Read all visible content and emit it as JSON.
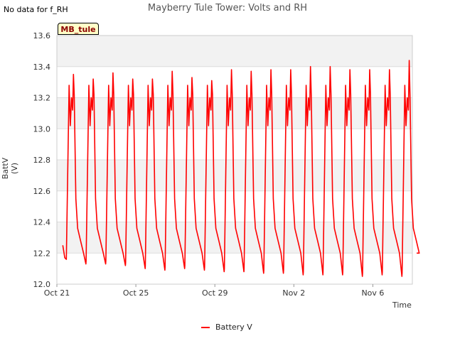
{
  "header": {
    "no_data_note": "No data for f_RH",
    "title": "Mayberry Tule Tower: Volts and RH",
    "site_tag": "MB_tule"
  },
  "chart_data": {
    "type": "line",
    "title": "Mayberry Tule Tower: Volts and RH",
    "xlabel": "Time",
    "ylabel": "BattV (V)",
    "ylim": [
      12.0,
      13.6
    ],
    "yticks": [
      "12.0",
      "12.2",
      "12.4",
      "12.6",
      "12.8",
      "13.0",
      "13.2",
      "13.4",
      "13.6"
    ],
    "xlim": [
      0,
      18
    ],
    "xticks": [
      {
        "label": "Oct 21",
        "day": 0
      },
      {
        "label": "Oct 25",
        "day": 4
      },
      {
        "label": "Oct 29",
        "day": 8
      },
      {
        "label": "Nov 2",
        "day": 12
      },
      {
        "label": "Nov 6",
        "day": 16
      }
    ],
    "grid": true,
    "legend_position": "bottom-center",
    "series": [
      {
        "name": "Battery V",
        "color": "#ff0000",
        "daily_cycles": [
          {
            "day": 0,
            "min": 12.14,
            "max": 13.35
          },
          {
            "day": 1,
            "min": 12.13,
            "max": 13.32
          },
          {
            "day": 2,
            "min": 12.13,
            "max": 13.36
          },
          {
            "day": 3,
            "min": 12.12,
            "max": 13.32
          },
          {
            "day": 4,
            "min": 12.1,
            "max": 13.32
          },
          {
            "day": 5,
            "min": 12.09,
            "max": 13.37
          },
          {
            "day": 6,
            "min": 12.1,
            "max": 13.33
          },
          {
            "day": 7,
            "min": 12.09,
            "max": 13.31
          },
          {
            "day": 8,
            "min": 12.08,
            "max": 13.38
          },
          {
            "day": 9,
            "min": 12.08,
            "max": 13.37
          },
          {
            "day": 10,
            "min": 12.07,
            "max": 13.38
          },
          {
            "day": 11,
            "min": 12.07,
            "max": 13.38
          },
          {
            "day": 12,
            "min": 12.06,
            "max": 13.4
          },
          {
            "day": 13,
            "min": 12.06,
            "max": 13.4
          },
          {
            "day": 14,
            "min": 12.06,
            "max": 13.38
          },
          {
            "day": 15,
            "min": 12.05,
            "max": 13.38
          },
          {
            "day": 16,
            "min": 12.06,
            "max": 13.38
          },
          {
            "day": 17,
            "min": 12.05,
            "max": 13.44
          }
        ]
      }
    ]
  }
}
